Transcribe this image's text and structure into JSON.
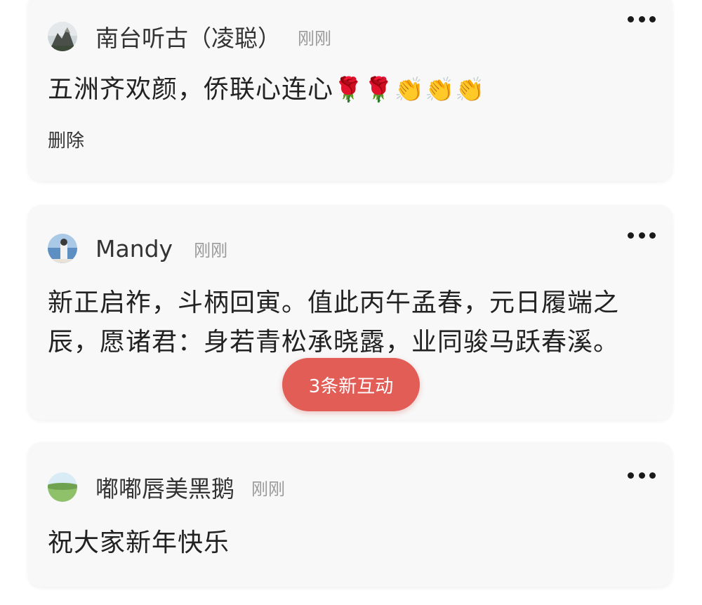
{
  "comments": [
    {
      "username": "南台听古（凌聪）",
      "time": "刚刚",
      "text": "五洲齐欢颜，侨联心连心",
      "emojis": "🌹🌹👏👏👏",
      "action": "删除",
      "avatar_icon": "mountain-photo-avatar"
    },
    {
      "username": "Mandy",
      "time": "刚刚",
      "text": "新正启祚，斗柄回寅。值此丙午孟春，元日履端之辰，愿诸君：身若青松承晓露，业同骏马跃春溪。",
      "avatar_icon": "sea-photo-avatar"
    },
    {
      "username": "嘟嘟唇美黑鹅",
      "time": "刚刚",
      "text": "祝大家新年快乐",
      "avatar_icon": "grassland-photo-avatar"
    }
  ],
  "new_interactions_label": "3条新互动",
  "colors": {
    "card_background": "#f8f8f8",
    "badge_red": "#e35d57",
    "time_gray": "#9a9a9a"
  }
}
